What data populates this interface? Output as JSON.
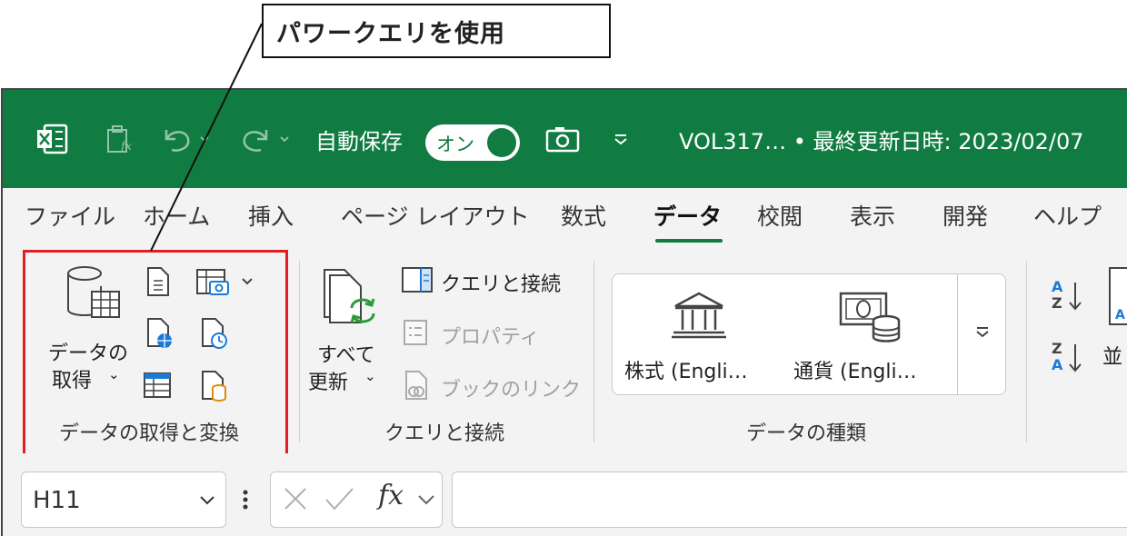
{
  "callout": {
    "text": "パワークエリを使用"
  },
  "titlebar": {
    "autosave_label": "自動保存",
    "autosave_state": "オン",
    "file_status": "VOL317… • 最終更新日時: 2023/02/07"
  },
  "tabs": [
    "ファイル",
    "ホーム",
    "挿入",
    "ページ レイアウト",
    "数式",
    "データ",
    "校閲",
    "表示",
    "開発",
    "ヘルプ"
  ],
  "active_tab": "データ",
  "ribbon": {
    "get_data": {
      "line1": "データの",
      "line2": "取得",
      "group": "データの取得と変換"
    },
    "queries": {
      "refresh_line1": "すべて",
      "refresh_line2": "更新",
      "queries_connections": "クエリと接続",
      "properties": "プロパティ",
      "workbook_links": "ブックのリンク",
      "group": "クエリと接続"
    },
    "data_types": {
      "stocks": "株式 (Engli…",
      "currencies": "通貨 (Engli…",
      "group": "データの種類"
    },
    "sort": {
      "label": "並"
    }
  },
  "formula": {
    "name_box": "H11",
    "fx": "fx"
  },
  "colors": {
    "excel_green": "#107c41",
    "highlight_red": "#e02020"
  }
}
